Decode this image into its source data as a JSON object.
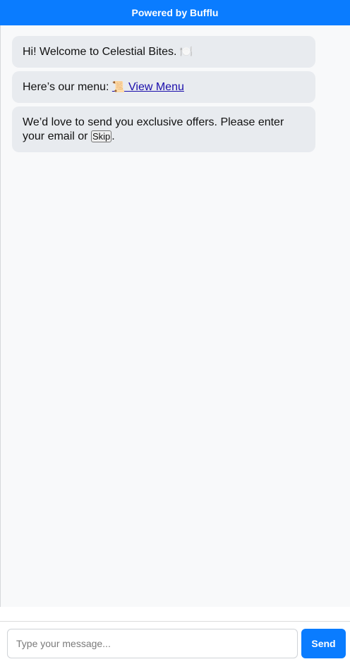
{
  "header": {
    "title": "Powered by Bufflu"
  },
  "messages": [
    {
      "text": "Hi! Welcome to Celestial Bites.",
      "emoji": "🍽️"
    },
    {
      "prefix": "Here’s our menu: ",
      "emoji": "📜",
      "link_label": "View Menu"
    },
    {
      "text": "We’d love to send you exclusive offers. Please enter your email or",
      "skip_label": "Skip",
      "suffix": "."
    }
  ],
  "composer": {
    "placeholder": "Type your message...",
    "send_label": "Send"
  },
  "colors": {
    "accent": "#0a7cff",
    "bubble": "#e8ebef",
    "chat_bg": "#f8f9fa",
    "link": "#1a0dab"
  },
  "icons": [
    "plate-icon",
    "scroll-icon"
  ]
}
